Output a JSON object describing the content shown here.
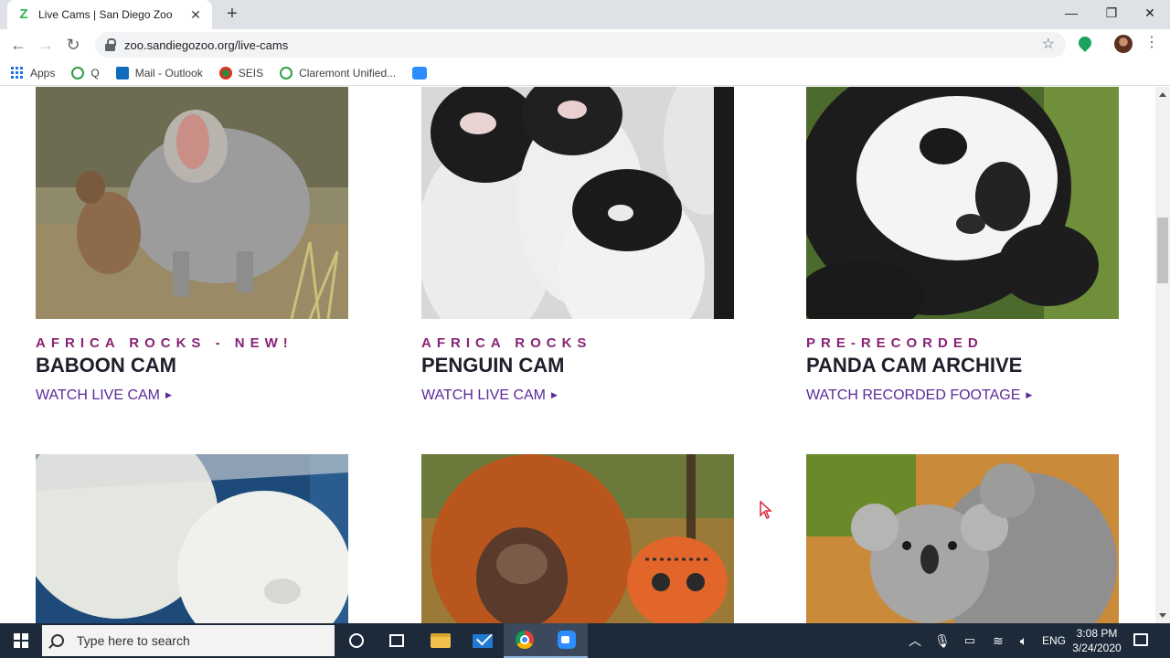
{
  "browser": {
    "tab_title": "Live Cams | San Diego Zoo",
    "tab_favicon": "Z",
    "url": "zoo.sandiegozoo.org/live-cams",
    "bookmarks": [
      {
        "label": "Apps",
        "icon": "apps-grid-icon"
      },
      {
        "label": "Q",
        "icon": "q-icon"
      },
      {
        "label": "Mail - Outlook",
        "icon": "outlook-icon"
      },
      {
        "label": "SEIS",
        "icon": "seis-icon"
      },
      {
        "label": "Claremont Unified...",
        "icon": "q-icon"
      },
      {
        "label": "",
        "icon": "zoom-icon"
      }
    ]
  },
  "cards": [
    {
      "kicker": "AFRICA ROCKS - NEW!",
      "title": "BABOON CAM",
      "link": "WATCH LIVE CAM",
      "image": "baboon"
    },
    {
      "kicker": "AFRICA ROCKS",
      "title": "PENGUIN CAM",
      "link": "WATCH LIVE CAM",
      "image": "penguins"
    },
    {
      "kicker": "PRE-RECORDED",
      "title": "PANDA CAM ARCHIVE",
      "link": "WATCH RECORDED FOOTAGE",
      "image": "panda"
    },
    {
      "image": "polar-bear"
    },
    {
      "image": "orangutan"
    },
    {
      "image": "koala"
    }
  ],
  "colors": {
    "kicker": "#8a2376",
    "link": "#5a2a9a",
    "title": "#1f1f2b"
  },
  "taskbar": {
    "search_placeholder": "Type here to search",
    "language": "ENG",
    "time": "3:08 PM",
    "date": "3/24/2020"
  }
}
